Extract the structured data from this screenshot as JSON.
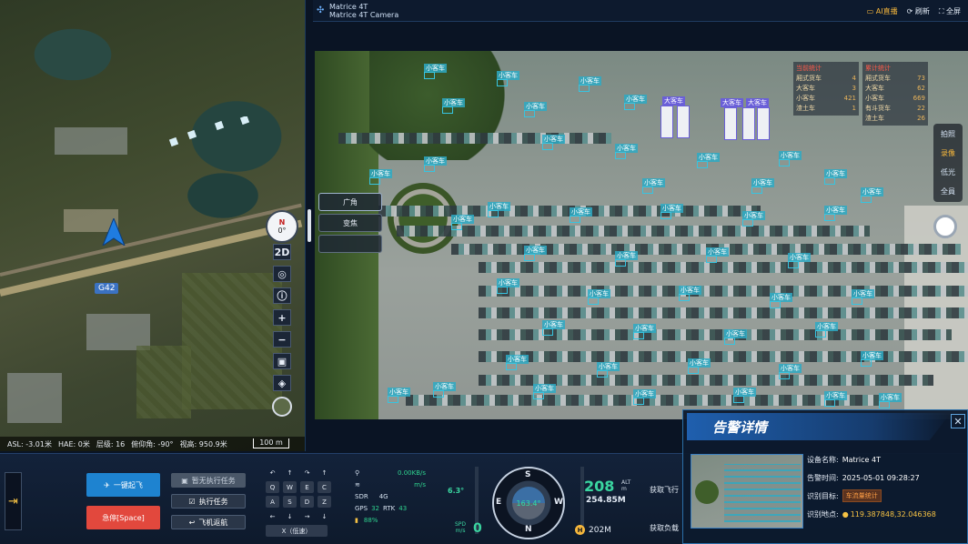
{
  "map": {
    "road_label": "G42",
    "compass": {
      "dir": "N",
      "angle": "0°"
    },
    "tools": [
      {
        "name": "view-2d-button",
        "label": "2D"
      },
      {
        "name": "locate-button",
        "label": "◎"
      },
      {
        "name": "info-button",
        "label": "ⓘ"
      },
      {
        "name": "zoom-in-button",
        "label": "+"
      },
      {
        "name": "zoom-out-button",
        "label": "−"
      },
      {
        "name": "map-mode-button",
        "label": "▣"
      },
      {
        "name": "layers-button",
        "label": "◈"
      }
    ],
    "status": {
      "asl": "ASL: -3.01米",
      "hae": "HAE: 0米",
      "level": "层级: 16",
      "pitch": "俯仰角: -90°",
      "range": "视高: 950.9米",
      "scale": "100 m"
    }
  },
  "camera": {
    "device": "Matrice 4T",
    "camera_name": "Matrice 4T Camera",
    "actions": [
      "AI直播",
      "刷新",
      "全屏"
    ],
    "lens_buttons": [
      "广角",
      "变焦",
      ""
    ],
    "mode_buttons": [
      "拍照",
      "录像",
      "低光",
      "全員"
    ],
    "stats": {
      "current": {
        "title": "当前统计",
        "rows": [
          [
            "厢式货车",
            "4"
          ],
          [
            "大客车",
            "3"
          ],
          [
            "小客车",
            "421"
          ],
          [
            "渣土车",
            "1"
          ]
        ]
      },
      "total": {
        "title": "累计统计",
        "rows": [
          [
            "厢式货车",
            "73"
          ],
          [
            "大客车",
            "62"
          ],
          [
            "小客车",
            "669"
          ],
          [
            "有斗货车",
            "22"
          ],
          [
            "渣土车",
            "26"
          ]
        ]
      }
    },
    "det_label": "小客车",
    "bus_label": "大客车"
  },
  "controls": {
    "takeoff": "一键起飞",
    "emergency": "急停[Space]",
    "pause": "暂无执行任务",
    "execute": "执行任务",
    "return": "飞机返航",
    "keys_top": [
      "↶",
      "↑",
      "↷",
      "↑"
    ],
    "keys_1": [
      "Q",
      "W",
      "E",
      "C"
    ],
    "keys_2": [
      "A",
      "S",
      "D",
      "Z"
    ],
    "keys_3": [
      "←",
      "↓",
      "→",
      "↓"
    ],
    "key_wide": "X（低速）",
    "telemetry": {
      "link": "0.00KB/s",
      "wind": "m/s",
      "sdr": "SDR",
      "net": "4G",
      "gps_label": "GPS",
      "gps": "32",
      "rtk_label": "RTK",
      "rtk": "43",
      "battery": "88%"
    },
    "pitch_angle": "6.3°",
    "spd_label": "SPD",
    "spd_unit": "m/s",
    "spd": "0",
    "heading": "163.4°",
    "cardinals": [
      "S",
      "W",
      "N",
      "E"
    ],
    "alt": "208",
    "alt_label": "ALT",
    "alt_unit": "m",
    "alt_abs": "254.85M",
    "home_dist": "202M",
    "fetch1": "获取飞行",
    "fetch2": "获取负载"
  },
  "alert": {
    "title": "告警详情",
    "device_label": "设备名称:",
    "device": "Matrice 4T",
    "time_label": "告警时间:",
    "time": "2025-05-01 09:28:27",
    "target_label": "识别目标:",
    "target": "车流量统计",
    "loc_label": "识别地点:",
    "loc": "119.387848,32.046368"
  }
}
